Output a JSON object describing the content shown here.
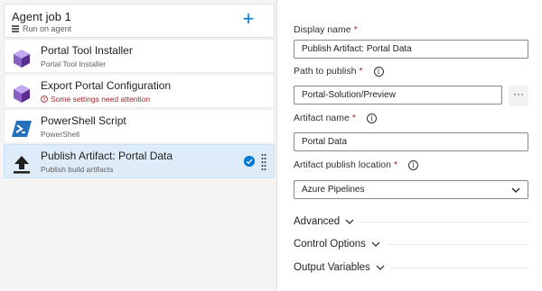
{
  "job": {
    "title": "Agent job 1",
    "subtitle": "Run on agent",
    "add_label": "+"
  },
  "tasks": [
    {
      "title": "Portal Tool Installer",
      "subtitle": "Portal Tool Installer",
      "icon": "portal-icon"
    },
    {
      "title": "Export Portal Configuration",
      "subtitle": "Some settings need attention",
      "icon": "portal-icon",
      "warning": true
    },
    {
      "title": "PowerShell Script",
      "subtitle": "PowerShell",
      "icon": "powershell-icon"
    },
    {
      "title": "Publish Artifact: Portal Data",
      "subtitle": "Publish build artifacts",
      "icon": "upload-icon",
      "selected": true
    }
  ],
  "form": {
    "display_name_label": "Display name",
    "display_name_value": "Publish Artifact: Portal Data",
    "path_label": "Path to publish",
    "path_value": "Portal-Solution/Preview",
    "ellipsis_label": "···",
    "artifact_name_label": "Artifact name",
    "artifact_name_value": "Portal Data",
    "location_label": "Artifact publish location",
    "location_value": "Azure Pipelines",
    "required_mark": "*",
    "info_mark": "i"
  },
  "sections": [
    "Advanced",
    "Control Options",
    "Output Variables"
  ],
  "colors": {
    "accent": "#0078d4",
    "warning": "#a4262c",
    "selected_bg": "#deecf9",
    "left_bg": "#f4f4f4"
  }
}
